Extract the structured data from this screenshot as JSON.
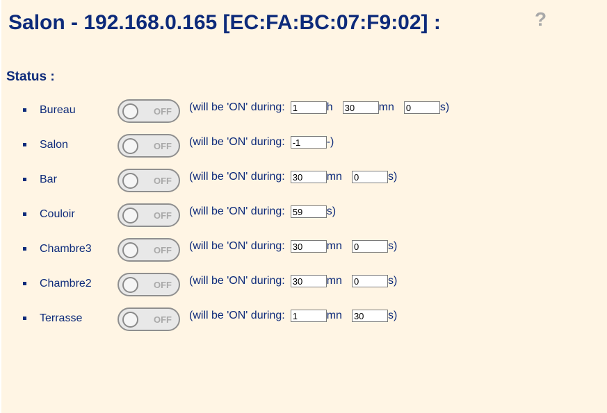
{
  "header": {
    "title": "Salon - 192.168.0.165 [EC:FA:BC:07:F9:02] :",
    "help_label": "?"
  },
  "status": {
    "label": "Status :",
    "toggle_off_label": "OFF",
    "during_prefix": "(will be 'ON' during:",
    "rows": [
      {
        "name": "Bureau",
        "fields": [
          {
            "value": "1",
            "unit": "h"
          },
          {
            "value": "30",
            "unit": "mn"
          },
          {
            "value": "0",
            "unit": "s)"
          }
        ]
      },
      {
        "name": "Salon",
        "fields": [
          {
            "value": "-1",
            "unit": "-)"
          }
        ]
      },
      {
        "name": "Bar",
        "fields": [
          {
            "value": "30",
            "unit": "mn"
          },
          {
            "value": "0",
            "unit": "s)"
          }
        ]
      },
      {
        "name": "Couloir",
        "fields": [
          {
            "value": "59",
            "unit": "s)"
          }
        ]
      },
      {
        "name": "Chambre3",
        "fields": [
          {
            "value": "30",
            "unit": "mn"
          },
          {
            "value": "0",
            "unit": "s)"
          }
        ]
      },
      {
        "name": "Chambre2",
        "fields": [
          {
            "value": "30",
            "unit": "mn"
          },
          {
            "value": "0",
            "unit": "s)"
          }
        ]
      },
      {
        "name": "Terrasse",
        "fields": [
          {
            "value": "1",
            "unit": "mn"
          },
          {
            "value": "30",
            "unit": "s)"
          }
        ]
      }
    ]
  },
  "colors": {
    "background": "#fff5e4",
    "text": "#0d2a7a",
    "help": "#a8a8a8"
  }
}
